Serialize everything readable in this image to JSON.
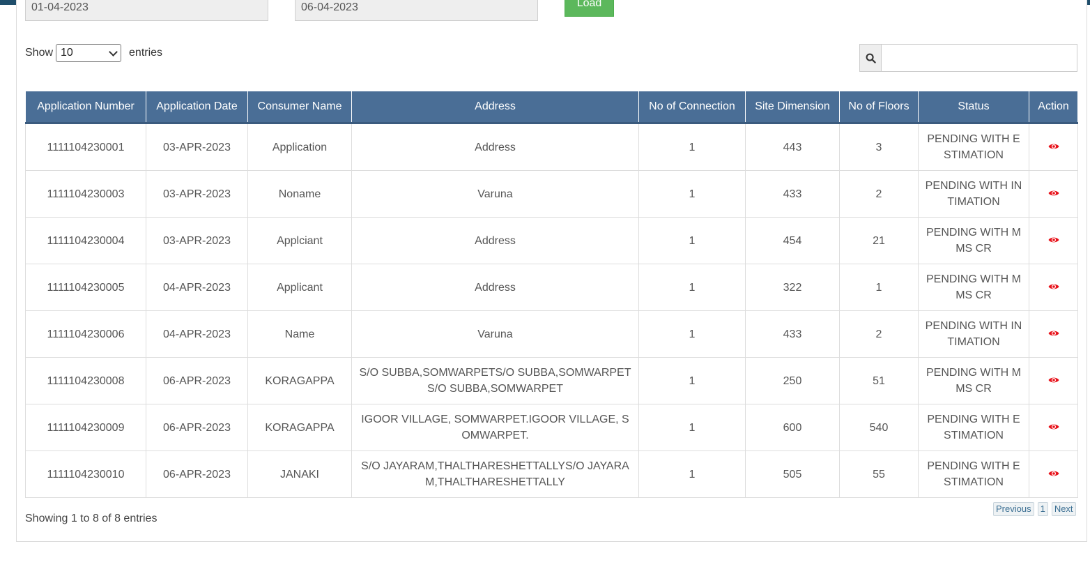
{
  "filters": {
    "from_date": "01-04-2023",
    "to_date": "06-04-2023",
    "load_label": "Load"
  },
  "length": {
    "show_label": "Show",
    "selected": "10",
    "entries_label": "entries"
  },
  "search": {
    "value": ""
  },
  "table": {
    "columns": [
      "Application Number",
      "Application Date",
      "Consumer Name",
      "Address",
      "No of Connection",
      "Site Dimension",
      "No of Floors",
      "Status",
      "Action"
    ],
    "rows": [
      [
        "1111104230001",
        "03-APR-2023",
        "Application",
        "Address",
        "1",
        "443",
        "3",
        "PENDING WITH ESTIMATION"
      ],
      [
        "1111104230003",
        "03-APR-2023",
        "Noname",
        "Varuna",
        "1",
        "433",
        "2",
        "PENDING WITH INTIMATION"
      ],
      [
        "1111104230004",
        "03-APR-2023",
        "Applciant",
        "Address",
        "1",
        "454",
        "21",
        "PENDING WITH MMS CR"
      ],
      [
        "1111104230005",
        "04-APR-2023",
        "Applicant",
        "Address",
        "1",
        "322",
        "1",
        "PENDING WITH MMS CR"
      ],
      [
        "1111104230006",
        "04-APR-2023",
        "Name",
        "Varuna",
        "1",
        "433",
        "2",
        "PENDING WITH INTIMATION"
      ],
      [
        "1111104230008",
        "06-APR-2023",
        "KORAGAPPA",
        "S/O SUBBA,SOMWARPETS/O SUBBA,SOMWARPETS/O SUBBA,SOMWARPET",
        "1",
        "250",
        "51",
        "PENDING WITH MMS CR"
      ],
      [
        "1111104230009",
        "06-APR-2023",
        "KORAGAPPA",
        "IGOOR VILLAGE, SOMWARPET.IGOOR VILLAGE, SOMWARPET.",
        "1",
        "600",
        "540",
        "PENDING WITH ESTIMATION"
      ],
      [
        "1111104230010",
        "06-APR-2023",
        "JANAKI",
        "S/O JAYARAM,THALTHARESHETTALLYS/O JAYARAM,THALTHARESHETTALLY",
        "1",
        "505",
        "55",
        "PENDING WITH ESTIMATION"
      ]
    ],
    "action_icon": "eye-icon",
    "action_color": "#e8121a"
  },
  "info": "Showing 1 to 8 of 8 entries",
  "pagination": {
    "previous": "Previous",
    "page": "1",
    "next": "Next"
  },
  "colors": {
    "header_bg": "#4a6e96",
    "load_button": "#5cb85c",
    "topbar": "#1f4e6b"
  }
}
